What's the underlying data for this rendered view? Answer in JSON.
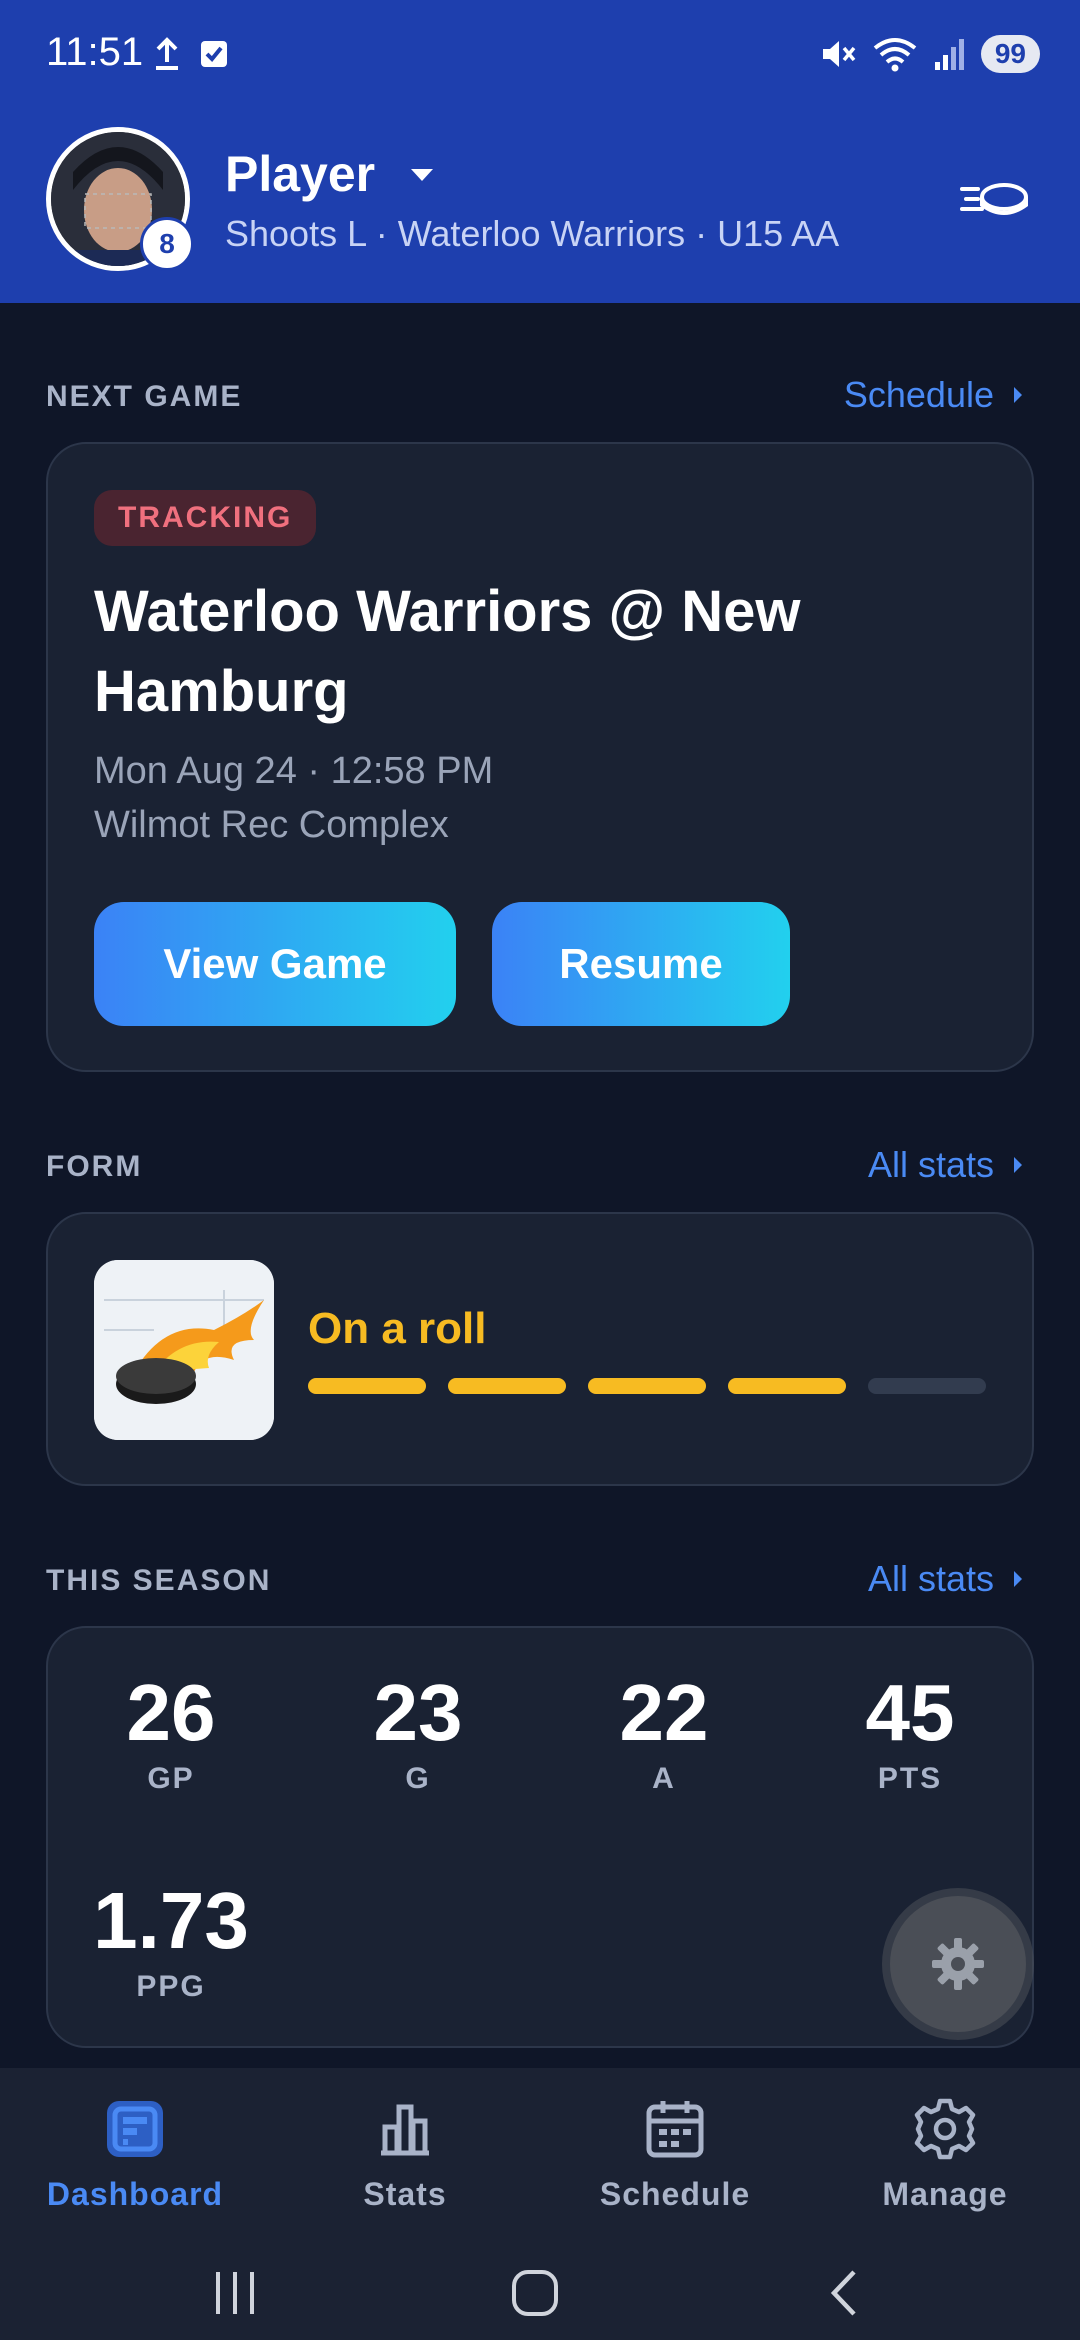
{
  "status_bar": {
    "time": "11:51",
    "battery": "99"
  },
  "header": {
    "player_name": "Player",
    "jersey_number": "8",
    "subtitle": "Shoots L · Waterloo Warriors · U15 AA"
  },
  "next_game": {
    "section_title": "NEXT GAME",
    "link_label": "Schedule",
    "badge": "TRACKING",
    "title": "Waterloo Warriors @ New Hamburg",
    "when": "Mon Aug 24 · 12:58 PM",
    "where": "Wilmot Rec Complex",
    "view_button": "View Game",
    "resume_button": "Resume"
  },
  "form": {
    "section_title": "FORM",
    "link_label": "All stats",
    "label": "On a roll",
    "streak": [
      true,
      true,
      true,
      true,
      false
    ]
  },
  "season": {
    "section_title": "THIS SEASON",
    "link_label": "All stats",
    "stats": [
      {
        "value": "26",
        "label": "GP"
      },
      {
        "value": "23",
        "label": "G"
      },
      {
        "value": "22",
        "label": "A"
      },
      {
        "value": "45",
        "label": "PTS"
      },
      {
        "value": "1.73",
        "label": "PPG"
      }
    ]
  },
  "nav": {
    "items": [
      {
        "label": "Dashboard",
        "icon": "dashboard-icon",
        "active": true
      },
      {
        "label": "Stats",
        "icon": "bar-chart-icon",
        "active": false
      },
      {
        "label": "Schedule",
        "icon": "calendar-icon",
        "active": false
      },
      {
        "label": "Manage",
        "icon": "gear-icon",
        "active": false
      }
    ]
  },
  "colors": {
    "header_bg": "#1e3fae",
    "page_bg": "#0f1628",
    "card_bg": "#1a2233",
    "accent": "#4a8af4",
    "form_yellow": "#f7bb22",
    "tracking_red": "#f0707e"
  }
}
